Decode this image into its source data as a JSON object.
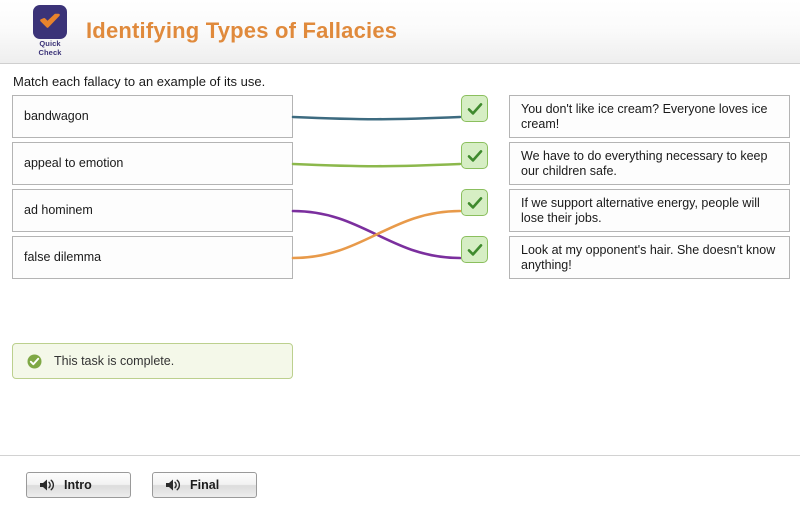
{
  "header": {
    "logo": {
      "icon": "check-icon",
      "line1": "Quick",
      "line2": "Check",
      "badge_color": "#3b3378",
      "check_color": "#e8832c"
    },
    "title": "Identifying Types of Fallacies",
    "title_color": "#e08a3c"
  },
  "instruction": "Match each fallacy to an example of its use.",
  "match": {
    "prompts": [
      {
        "label": "bandwagon",
        "line_color": "#3d6b80"
      },
      {
        "label": "appeal to emotion",
        "line_color": "#8cb84c"
      },
      {
        "label": "ad hominem",
        "line_color": "#7b2f9e"
      },
      {
        "label": "false dilemma",
        "line_color": "#e89a4a"
      }
    ],
    "answers": [
      {
        "text": "You don't like ice cream? Everyone loves ice cream!"
      },
      {
        "text": "We have to do everything necessary to keep our children safe."
      },
      {
        "text": "If we support alternative energy, people will lose their jobs."
      },
      {
        "text": "Look at my opponent's hair. She doesn't know anything!"
      }
    ],
    "connections": [
      {
        "from": 0,
        "to": 0,
        "color": "#3d6b80"
      },
      {
        "from": 1,
        "to": 1,
        "color": "#8cb84c"
      },
      {
        "from": 2,
        "to": 3,
        "color": "#7b2f9e"
      },
      {
        "from": 3,
        "to": 2,
        "color": "#e89a4a"
      }
    ],
    "badges": [
      {
        "icon": "check-icon",
        "state": "correct"
      },
      {
        "icon": "check-icon",
        "state": "correct"
      },
      {
        "icon": "check-icon",
        "state": "correct"
      },
      {
        "icon": "check-icon",
        "state": "correct"
      }
    ],
    "badge_colors": {
      "fill": "#d6eec4",
      "border": "#8bbf5e",
      "check": "#3f8a2e"
    }
  },
  "completion": {
    "icon": "check-circle-icon",
    "text": "This task is complete.",
    "fill": "#f4f8e9",
    "border": "#bcd08e",
    "icon_color": "#7fa845"
  },
  "bottom": {
    "buttons": [
      {
        "icon": "speaker-icon",
        "label": "Intro"
      },
      {
        "icon": "speaker-icon",
        "label": "Final"
      }
    ]
  }
}
